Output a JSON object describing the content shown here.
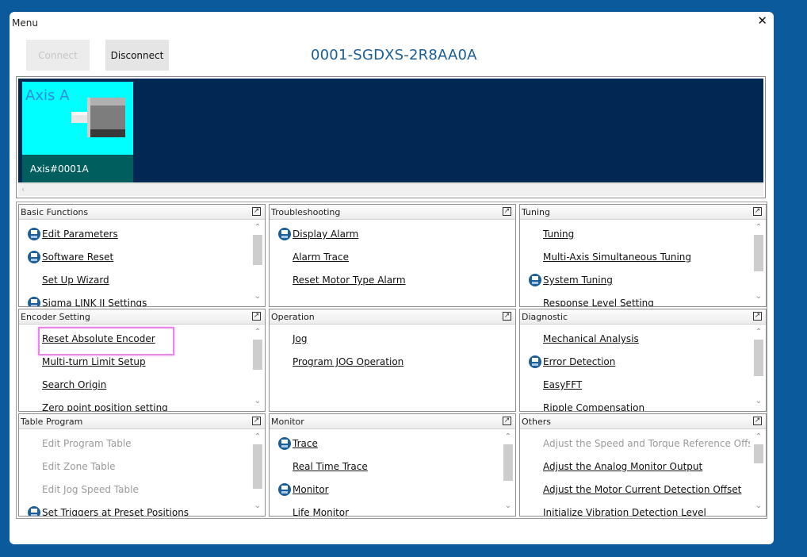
{
  "window": {
    "title": "Menu",
    "close": "✕"
  },
  "toolbar": {
    "connect_label": "Connect",
    "disconnect_label": "Disconnect"
  },
  "device": {
    "title": "0001-SGDXS-2R8AA0A"
  },
  "axis": {
    "label": "Axis A",
    "name": "Axis#0001A",
    "scroll_left": "‹"
  },
  "panels": [
    {
      "title": "Basic Functions",
      "items": [
        {
          "label": "Edit Parameters",
          "icon": "servo-icon"
        },
        {
          "label": "Software Reset",
          "icon": "servo-icon"
        },
        {
          "label": "Set Up Wizard"
        },
        {
          "label": "Sigma LINK II Settings",
          "icon": "servo-icon"
        }
      ]
    },
    {
      "title": "Troubleshooting",
      "items": [
        {
          "label": "Display Alarm",
          "icon": "servo-icon"
        },
        {
          "label": "Alarm Trace"
        },
        {
          "label": "Reset Motor Type Alarm"
        }
      ]
    },
    {
      "title": "Tuning",
      "items": [
        {
          "label": "Tuning"
        },
        {
          "label": "Multi-Axis Simultaneous Tuning"
        },
        {
          "label": "System Tuning",
          "icon": "servo-icon"
        },
        {
          "label": "Response Level Setting"
        }
      ]
    },
    {
      "title": "Encoder Setting",
      "items": [
        {
          "label": "Reset Absolute Encoder"
        },
        {
          "label": "Multi-turn Limit Setup"
        },
        {
          "label": "Search Origin"
        },
        {
          "label": "Zero point position setting"
        }
      ]
    },
    {
      "title": "Operation",
      "items": [
        {
          "label": "Jog"
        },
        {
          "label": "Program JOG Operation"
        }
      ]
    },
    {
      "title": "Diagnostic",
      "items": [
        {
          "label": "Mechanical Analysis"
        },
        {
          "label": "Error Detection",
          "icon": "servo-icon"
        },
        {
          "label": "EasyFFT"
        },
        {
          "label": "Ripple Compensation"
        }
      ]
    },
    {
      "title": "Table Program",
      "items": [
        {
          "label": "Edit Program Table",
          "disabled": true
        },
        {
          "label": "Edit Zone Table",
          "disabled": true
        },
        {
          "label": "Edit Jog Speed Table",
          "disabled": true
        },
        {
          "label": "Set Triggers at Preset Positions",
          "icon": "servo-icon"
        }
      ]
    },
    {
      "title": "Monitor",
      "items": [
        {
          "label": "Trace",
          "icon": "servo-icon"
        },
        {
          "label": "Real Time Trace"
        },
        {
          "label": "Monitor",
          "icon": "servo-icon"
        },
        {
          "label": "Life Monitor"
        }
      ]
    },
    {
      "title": "Others",
      "items": [
        {
          "label": "Adjust the Speed and Torque Reference Offset",
          "disabled": true
        },
        {
          "label": "Adjust the Analog Monitor Output"
        },
        {
          "label": "Adjust the Motor Current Detection Offset"
        },
        {
          "label": "Initialize Vibration Detection Level"
        }
      ]
    }
  ],
  "scroll_glyphs": {
    "up": "⌃",
    "down": "⌄"
  },
  "colors": {
    "accent": "#1a5e96",
    "axis_card": "#00ffff",
    "axis_footer": "#005e5e",
    "axis_bg": "#002852",
    "highlight": "#e887e8"
  }
}
